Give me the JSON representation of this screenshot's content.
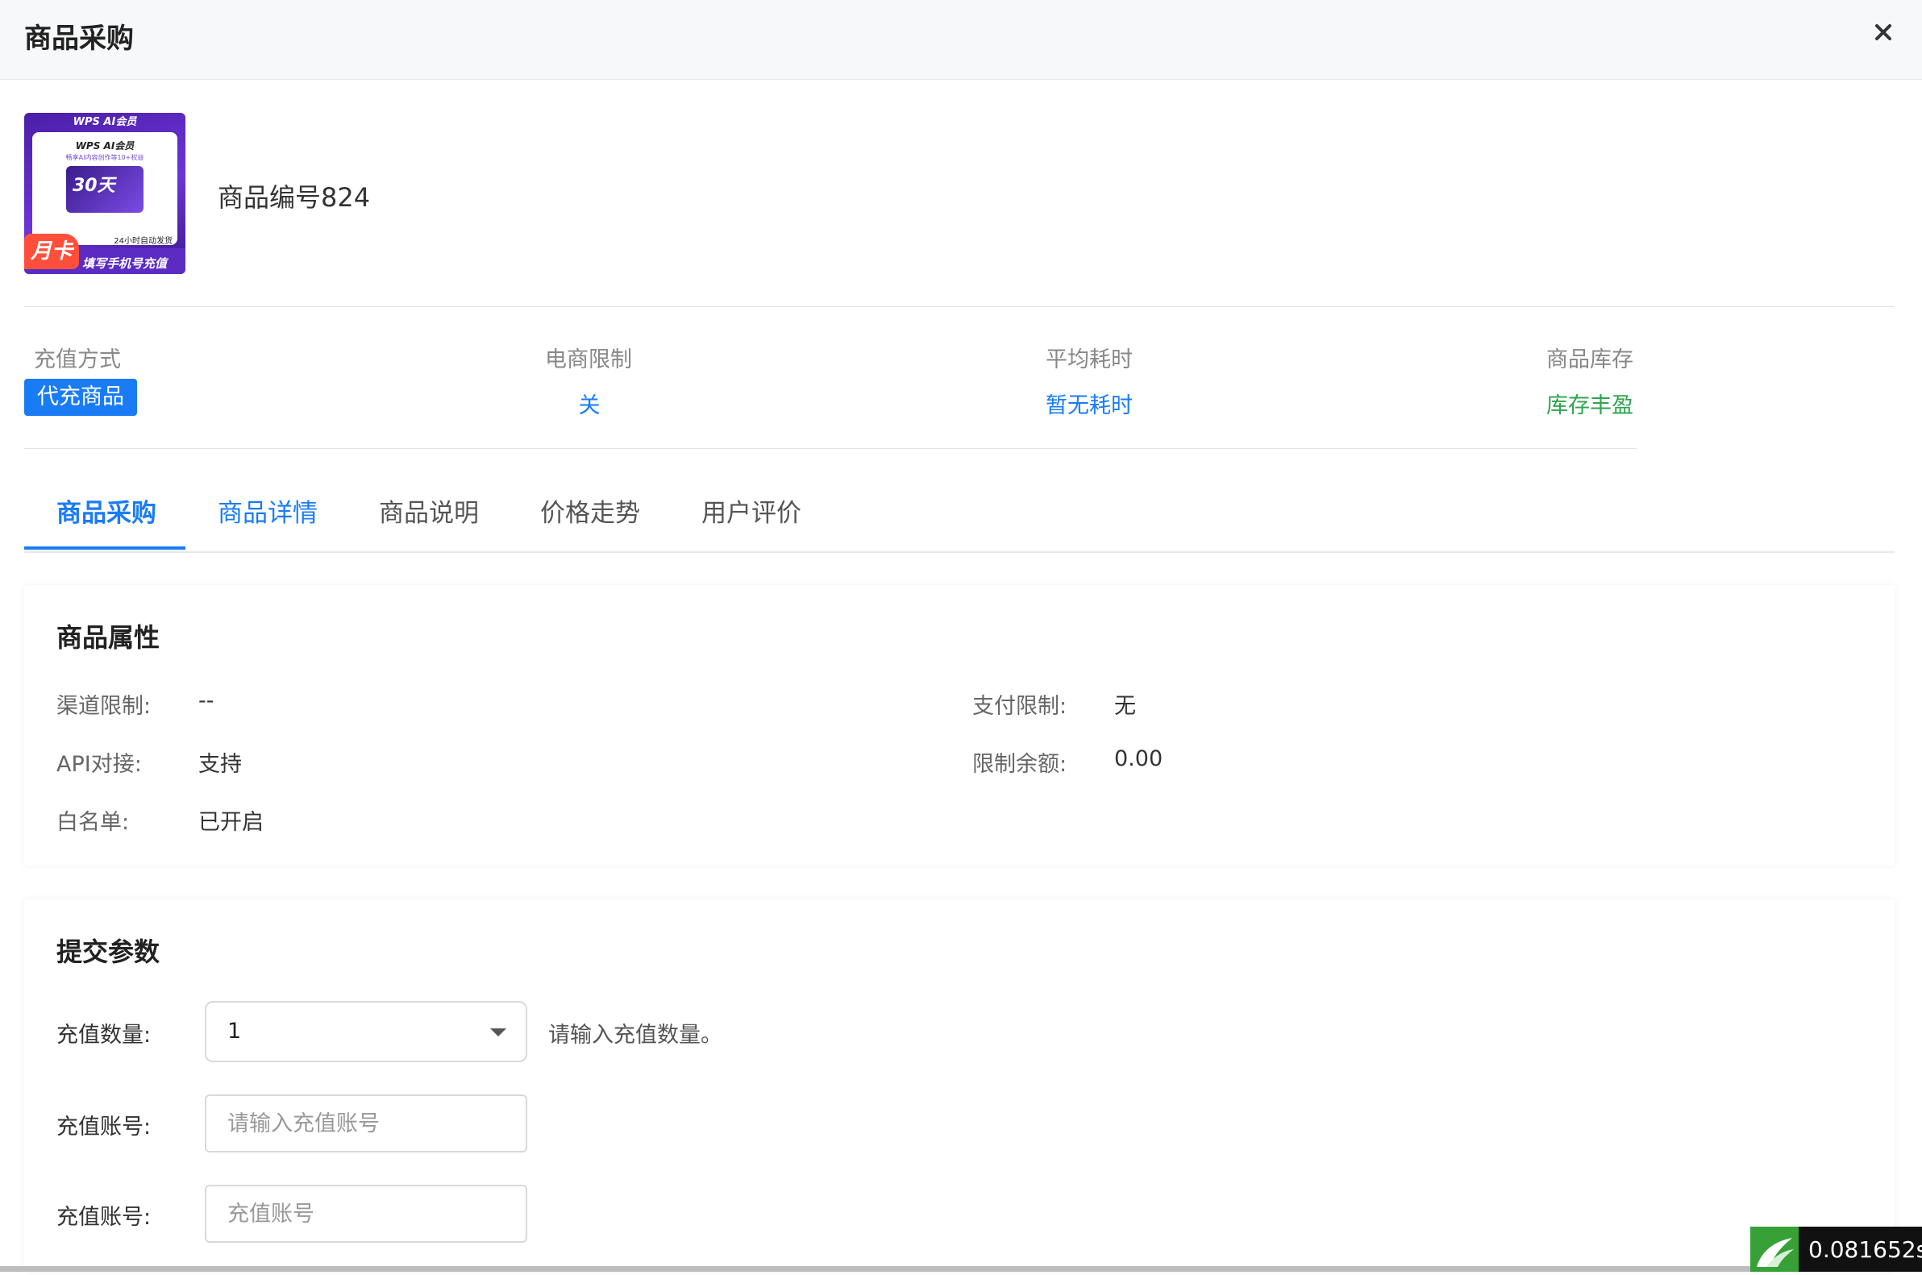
{
  "header": {
    "title": "商品采购"
  },
  "product": {
    "name": "商品编号824",
    "image": {
      "top_banner": "WPS AI会员",
      "brand": "WPS AI会员",
      "subtitle": "畅享AI内容创作等10+权益",
      "days": "30天",
      "shipping": "24小时自动发货",
      "month_badge": "月卡",
      "fill_text": "填写手机号充值"
    }
  },
  "stats": {
    "method": {
      "label": "充值方式",
      "value": "代充商品"
    },
    "ecommerce": {
      "label": "电商限制",
      "value": "关"
    },
    "avg_time": {
      "label": "平均耗时",
      "value": "暂无耗时"
    },
    "stock": {
      "label": "商品库存",
      "value": "库存丰盈"
    }
  },
  "tabs": [
    "商品采购",
    "商品详情",
    "商品说明",
    "价格走势",
    "用户评价"
  ],
  "attributes": {
    "title": "商品属性",
    "channel_limit": {
      "label": "渠道限制:",
      "value": "--"
    },
    "payment_limit": {
      "label": "支付限制:",
      "value": "无"
    },
    "api": {
      "label": "API对接:",
      "value": "支持"
    },
    "limit_balance": {
      "label": "限制余额:",
      "value": "0.00"
    },
    "whitelist": {
      "label": "白名单:",
      "value": "已开启"
    }
  },
  "submit": {
    "title": "提交参数",
    "quantity": {
      "label": "充值数量:",
      "value": "1",
      "help": "请输入充值数量。"
    },
    "account1": {
      "label": "充值账号:",
      "placeholder": "请输入充值账号"
    },
    "account2": {
      "label": "充值账号:",
      "placeholder": "充值账号"
    }
  },
  "timer": {
    "text": "0.081652s"
  },
  "colors": {
    "accent": "#1a7cf5",
    "success": "#2ea44f",
    "purple": "#5b2bc3"
  }
}
